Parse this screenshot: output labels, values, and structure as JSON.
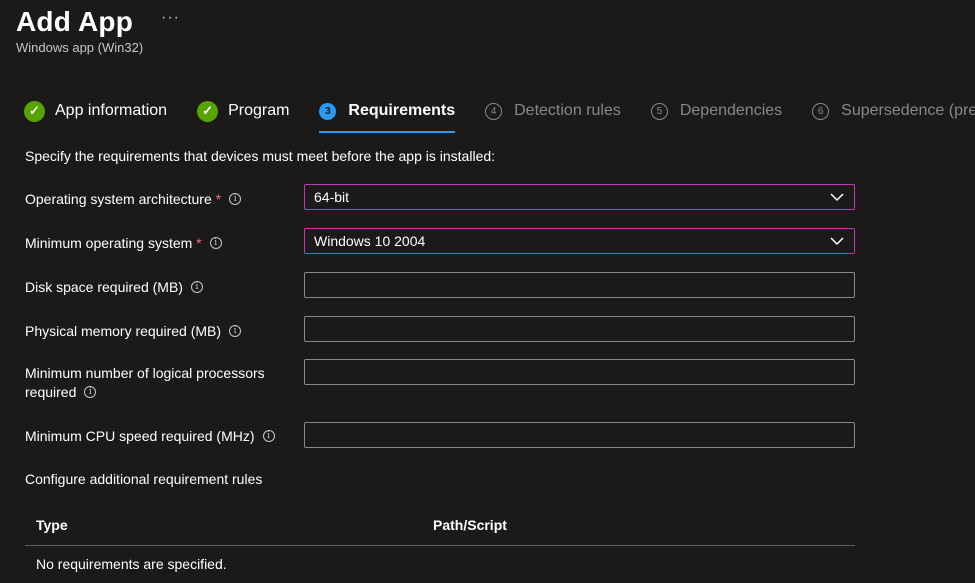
{
  "header": {
    "title": "Add App",
    "more": "···",
    "subtitle": "Windows app (Win32)"
  },
  "wizard": {
    "steps": [
      {
        "label": "App information",
        "state": "done",
        "icon": "check-icon"
      },
      {
        "label": "Program",
        "state": "done",
        "icon": "check-icon"
      },
      {
        "label": "Requirements",
        "state": "current",
        "number": "3"
      },
      {
        "label": "Detection rules",
        "state": "future",
        "number": "4"
      },
      {
        "label": "Dependencies",
        "state": "future",
        "number": "5"
      },
      {
        "label": "Supersedence (preview)",
        "state": "future",
        "number": "6"
      }
    ]
  },
  "intro": "Specify the requirements that devices must meet before the app is installed:",
  "fields": {
    "os_arch": {
      "label": "Operating system architecture",
      "required": "*",
      "value": "64-bit"
    },
    "min_os": {
      "label": "Minimum operating system",
      "required": "*",
      "value": "Windows 10 2004"
    },
    "disk": {
      "label": "Disk space required (MB)",
      "value": ""
    },
    "memory": {
      "label": "Physical memory required (MB)",
      "value": ""
    },
    "processors": {
      "label_line1": "Minimum number of logical processors",
      "label_line2": "required",
      "value": ""
    },
    "cpu": {
      "label": "Minimum CPU speed required (MHz)",
      "value": ""
    }
  },
  "info_glyph": "i",
  "config_label": "Configure additional requirement rules",
  "table": {
    "columns": [
      "Type",
      "Path/Script"
    ],
    "empty_message": "No requirements are specified."
  },
  "colors": {
    "background": "#1b1a19",
    "accent": "#2899f5",
    "success": "#57a300",
    "focus_border": "#c239b3",
    "required": "#f1707b"
  }
}
